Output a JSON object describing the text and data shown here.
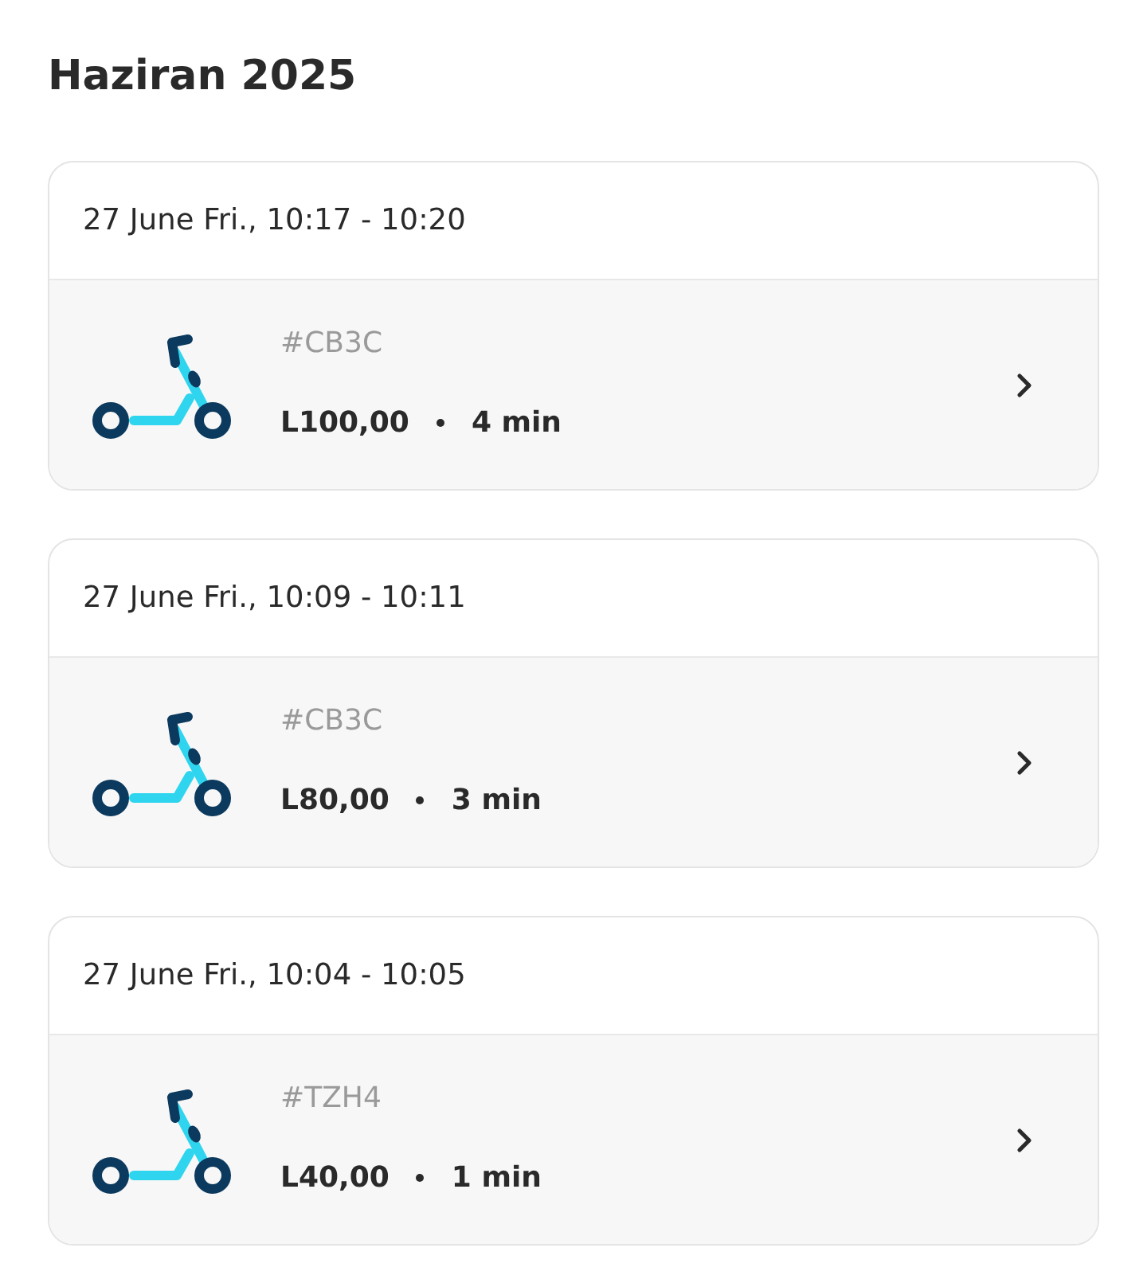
{
  "title": "Haziran 2025",
  "rides": [
    {
      "date_time": "27 June Fri., 10:17 - 10:20",
      "vehicle_code": "#CB3C",
      "price": "L100,00",
      "duration": "4 min"
    },
    {
      "date_time": "27 June Fri., 10:09 - 10:11",
      "vehicle_code": "#CB3C",
      "price": "L80,00",
      "duration": "3 min"
    },
    {
      "date_time": "27 June Fri., 10:04 - 10:05",
      "vehicle_code": "#TZH4",
      "price": "L40,00",
      "duration": "1 min"
    }
  ]
}
